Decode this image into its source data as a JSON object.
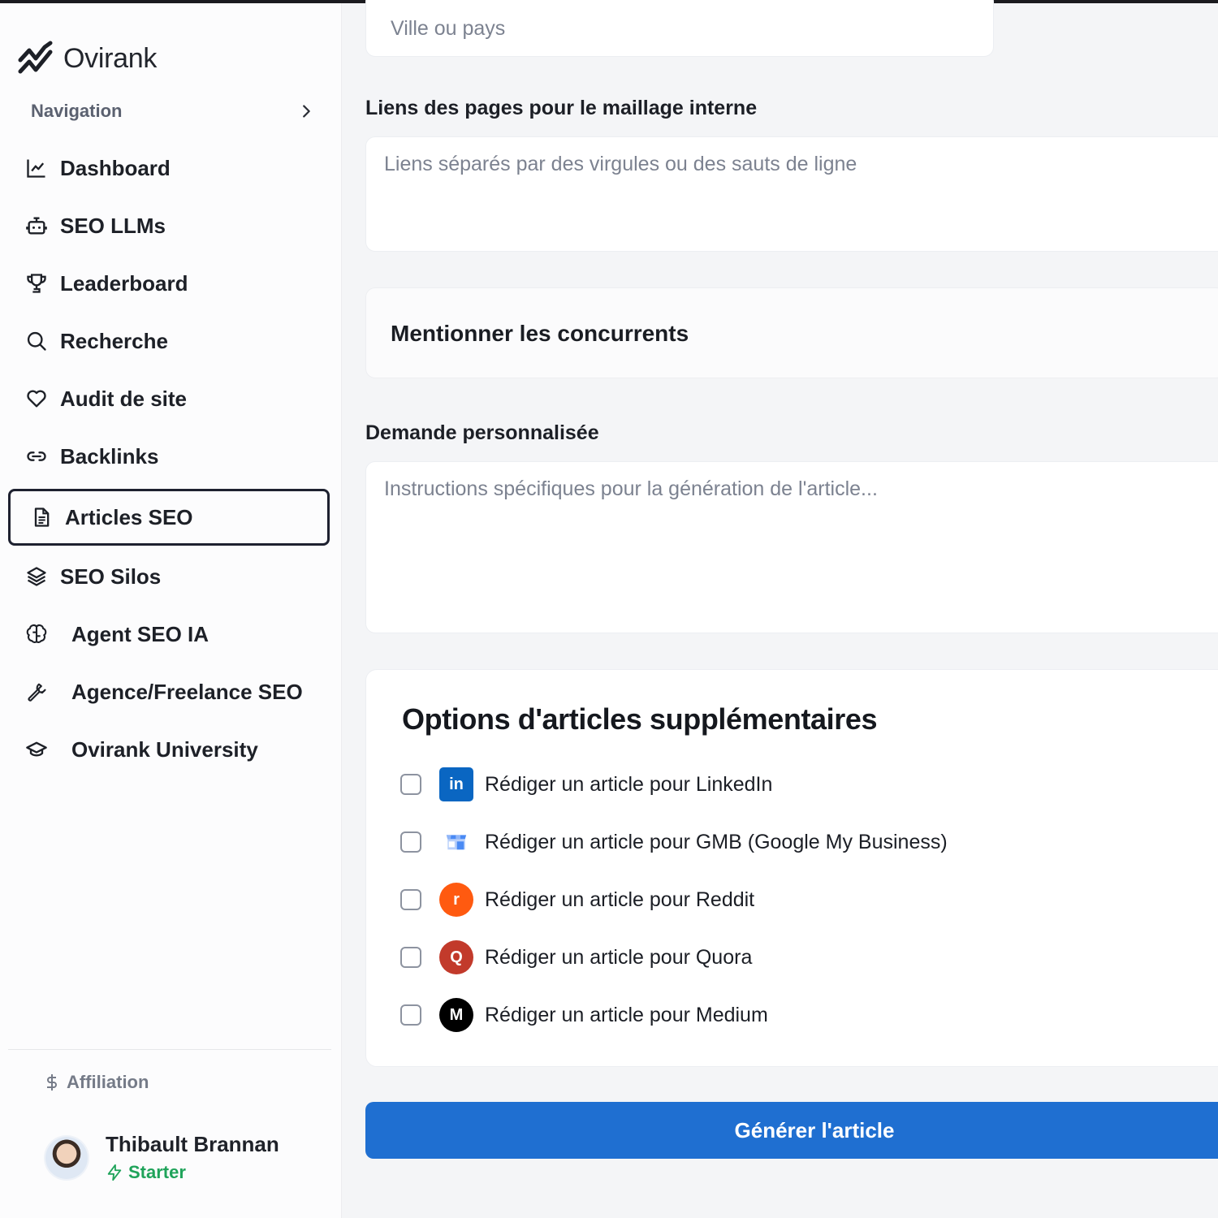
{
  "brand": {
    "name": "Ovirank"
  },
  "sidebar": {
    "section_label": "Navigation",
    "items": [
      {
        "label": "Dashboard",
        "icon": "chart-line-icon"
      },
      {
        "label": "SEO LLMs",
        "icon": "bot-icon"
      },
      {
        "label": "Leaderboard",
        "icon": "trophy-icon"
      },
      {
        "label": "Recherche",
        "icon": "search-icon"
      },
      {
        "label": "Audit de site",
        "icon": "heart-icon"
      },
      {
        "label": "Backlinks",
        "icon": "link-icon"
      },
      {
        "label": "Articles SEO",
        "icon": "file-text-icon",
        "active": true
      },
      {
        "label": "SEO Silos",
        "icon": "layers-icon"
      },
      {
        "label": "Agent SEO IA",
        "icon": "brain-icon"
      },
      {
        "label": "Agence/Freelance SEO",
        "icon": "wrench-icon"
      },
      {
        "label": "Ovirank University",
        "icon": "graduation-cap-icon"
      }
    ],
    "affiliation": "Affiliation",
    "user": {
      "name": "Thibault Brannan",
      "plan": "Starter"
    }
  },
  "form": {
    "location": {
      "placeholder": "Ville ou pays"
    },
    "internal_links": {
      "label": "Liens des pages pour le maillage interne",
      "placeholder": "Liens séparés par des virgules ou des sauts de ligne"
    },
    "competitors": {
      "title": "Mentionner les concurrents"
    },
    "custom_request": {
      "label": "Demande personnalisée",
      "placeholder": "Instructions spécifiques pour la génération de l'article..."
    },
    "extra_options": {
      "title": "Options d'articles supplémentaires",
      "options": [
        {
          "label": "Rédiger un article pour LinkedIn",
          "icon": "linkedin-icon",
          "icon_text": "in",
          "checked": false
        },
        {
          "label": "Rédiger un article pour GMB (Google My Business)",
          "icon": "google-my-business-icon",
          "checked": false
        },
        {
          "label": "Rédiger un article pour Reddit",
          "icon": "reddit-icon",
          "icon_text": "r",
          "checked": false
        },
        {
          "label": "Rédiger un article pour Quora",
          "icon": "quora-icon",
          "icon_text": "Q",
          "checked": false
        },
        {
          "label": "Rédiger un article pour Medium",
          "icon": "medium-icon",
          "icon_text": "M",
          "checked": false
        }
      ]
    },
    "submit_label": "Générer l'article"
  },
  "colors": {
    "primary": "#1f6fd1",
    "plan_green": "#1fa35a",
    "linkedin": "#0a66c2",
    "reddit": "#ff5a10",
    "quora": "#c23a2b",
    "medium": "#000000"
  }
}
